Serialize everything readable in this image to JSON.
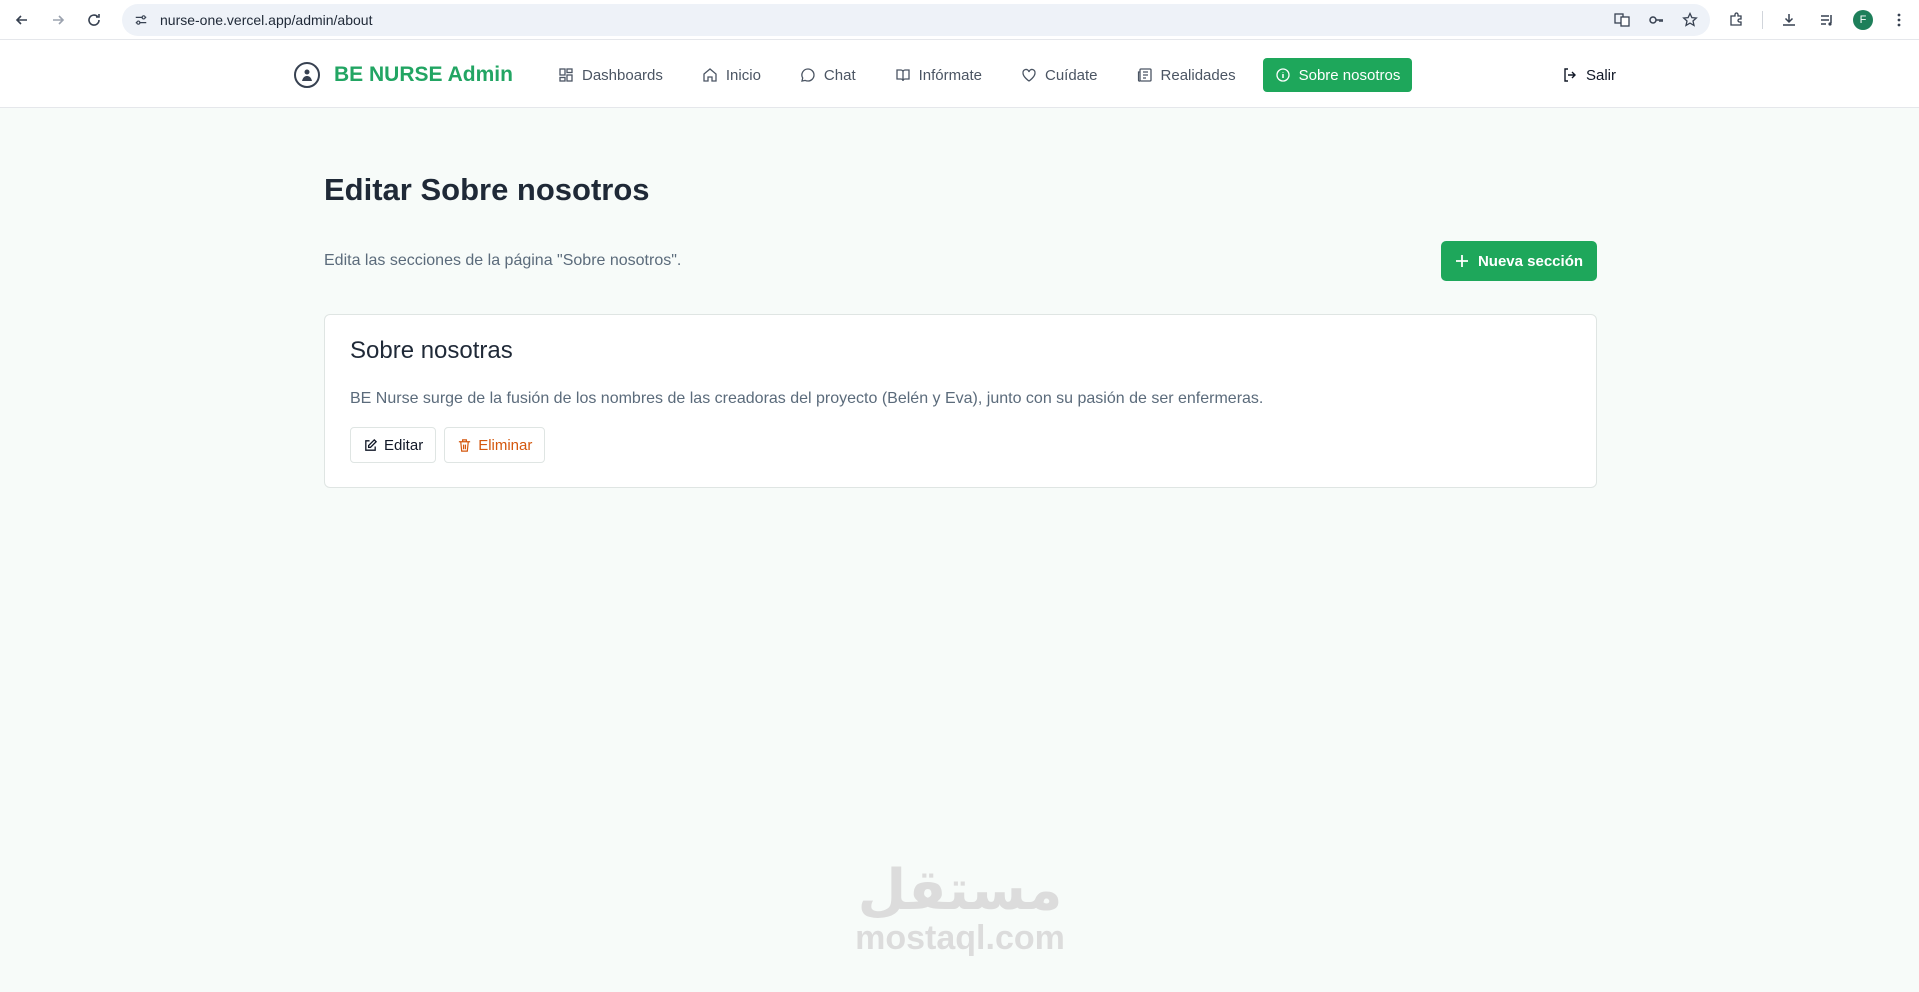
{
  "browser": {
    "url": "nurse-one.vercel.app/admin/about",
    "profile_initial": "F"
  },
  "header": {
    "brand": "BE NURSE Admin",
    "menu": [
      {
        "label": "Dashboards",
        "icon": "grid-icon"
      },
      {
        "label": "Inicio",
        "icon": "home-icon"
      },
      {
        "label": "Chat",
        "icon": "chat-icon"
      },
      {
        "label": "Infórmate",
        "icon": "book-icon"
      },
      {
        "label": "Cuídate",
        "icon": "heart-icon"
      },
      {
        "label": "Realidades",
        "icon": "newspaper-icon"
      },
      {
        "label": "Sobre nosotros",
        "icon": "info-icon",
        "active": true
      }
    ],
    "logout_label": "Salir"
  },
  "main": {
    "title": "Editar Sobre nosotros",
    "subtitle": "Edita las secciones de la página \"Sobre nosotros\".",
    "new_section_label": "Nueva sección",
    "sections": [
      {
        "title": "Sobre nosotras",
        "text": "BE Nurse surge de la fusión de los nombres de las creadoras del proyecto (Belén y Eva), junto con su pasión de ser enfermeras.",
        "edit_label": "Editar",
        "delete_label": "Eliminar"
      }
    ]
  },
  "watermark": {
    "arabic": "مستقل",
    "latin": "mostaql.com"
  },
  "colors": {
    "accent": "#1ea75b",
    "brand_text": "#22a563",
    "danger": "#d4570d"
  }
}
